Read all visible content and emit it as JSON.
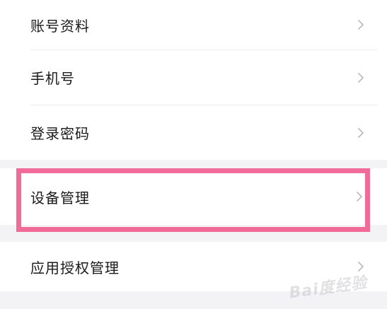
{
  "settings": {
    "items": [
      {
        "label": "账号资料"
      },
      {
        "label": "手机号"
      },
      {
        "label": "登录密码"
      },
      {
        "label": "设备管理"
      },
      {
        "label": "应用授权管理"
      }
    ]
  },
  "icons": {
    "chevron": "chevron-right-icon"
  },
  "colors": {
    "highlight": "#f06b98",
    "background": "#f3f3f6",
    "text": "#1a1a1a",
    "chevron": "#b8b8bc"
  },
  "watermark": {
    "text": "Bai度经验"
  }
}
